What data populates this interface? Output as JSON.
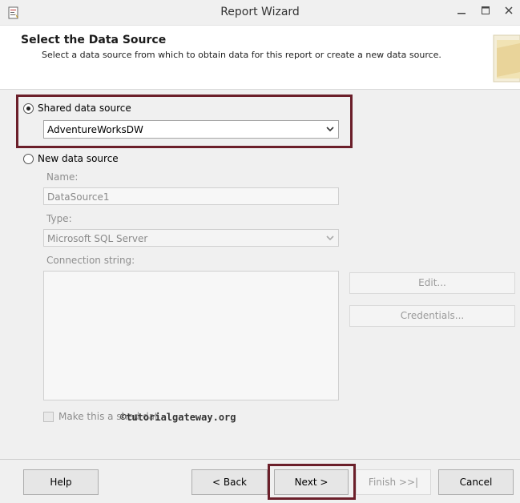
{
  "window": {
    "title": "Report Wizard",
    "icon": "report-wizard-icon",
    "controls": [
      "minimize-icon",
      "maximize-icon",
      "close-icon"
    ]
  },
  "header": {
    "title": "Select the Data Source",
    "description": "Select a data source from which to obtain data for this report or create a new data source."
  },
  "shared": {
    "label": "Shared data source",
    "selected": true,
    "value": "AdventureWorksDW"
  },
  "new_source": {
    "label": "New data source",
    "selected": false,
    "name_label": "Name:",
    "name_value": "DataSource1",
    "type_label": "Type:",
    "type_value": "Microsoft SQL Server",
    "conn_label": "Connection string:",
    "conn_value": "",
    "edit_label": "Edit...",
    "credentials_label": "Credentials...",
    "make_shared_label": "Make this a sh",
    "make_shared_label_tail": "ed dat"
  },
  "watermark": "©tutorialgateway.org",
  "footer": {
    "help": "Help",
    "back": "< Back",
    "next": "Next >",
    "finish": "Finish >>|",
    "cancel": "Cancel"
  },
  "colors": {
    "highlight": "#6b1f2a",
    "background": "#f0f0f0",
    "header_bg": "#ffffff"
  }
}
